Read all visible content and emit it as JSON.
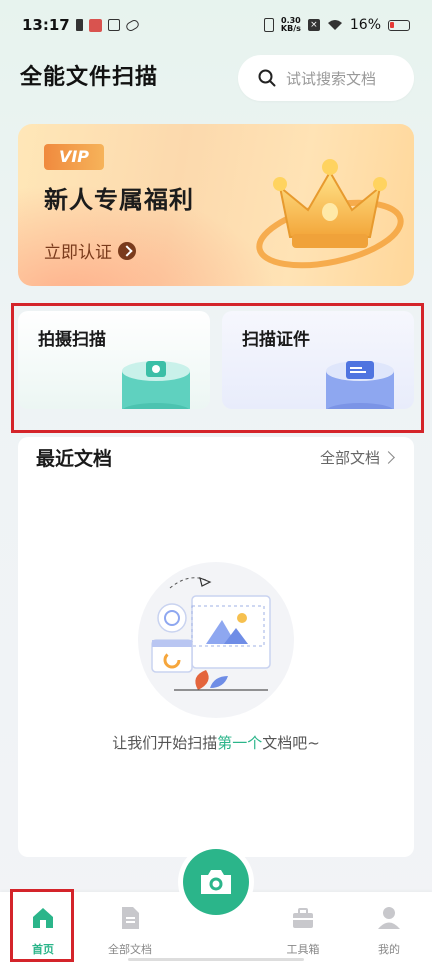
{
  "status_bar": {
    "time": "13:17",
    "net_speed_top": "0.30",
    "net_speed_bottom": "KB/s",
    "battery_percent": "16%"
  },
  "header": {
    "title": "全能文件扫描",
    "search_placeholder": "试试搜索文档",
    "search_icon": "search-icon"
  },
  "banner": {
    "badge": "VIP",
    "title": "新人专属福利",
    "link_label": "立即认证",
    "image": "crown-illustration"
  },
  "actions": [
    {
      "label": "拍摄扫描",
      "icon": "camera-cylinder-icon"
    },
    {
      "label": "扫描证件",
      "icon": "id-card-cylinder-icon"
    }
  ],
  "recent": {
    "title": "最近文档",
    "all_docs_label": "全部文档",
    "empty_text_before": "让我们开始扫描",
    "empty_text_highlight": "第一个",
    "empty_text_after": "文档吧~"
  },
  "bottom_nav": [
    {
      "label": "首页",
      "icon": "home-icon",
      "active": true
    },
    {
      "label": "全部文档",
      "icon": "document-icon",
      "active": false
    },
    {
      "label": "",
      "icon": "camera-icon",
      "active": false
    },
    {
      "label": "工具箱",
      "icon": "toolbox-icon",
      "active": false
    },
    {
      "label": "我的",
      "icon": "user-icon",
      "active": false
    }
  ],
  "colors": {
    "accent": "#2bb58a",
    "highlight_border": "#d4242a"
  }
}
